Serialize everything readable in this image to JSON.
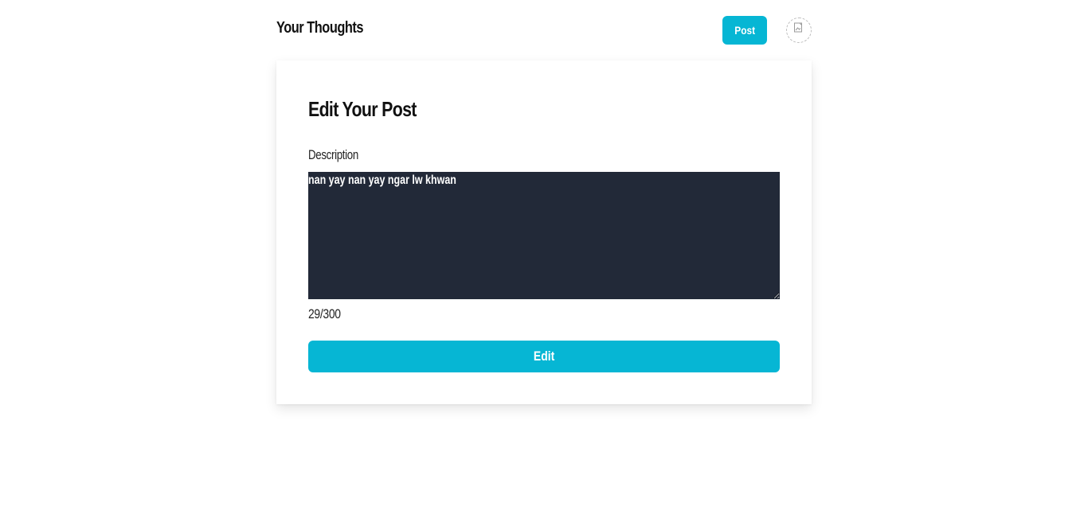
{
  "header": {
    "brand": "Your Thoughts",
    "post_label": "Post",
    "avatar_icon": "broken-image-icon"
  },
  "form": {
    "title": "Edit Your Post",
    "description_label": "Description",
    "description_value": "nan yay nan yay ngar lw khwan",
    "counter": "29/300",
    "submit_label": "Edit"
  },
  "colors": {
    "accent": "#06b6d4",
    "textarea_bg": "#222938"
  }
}
